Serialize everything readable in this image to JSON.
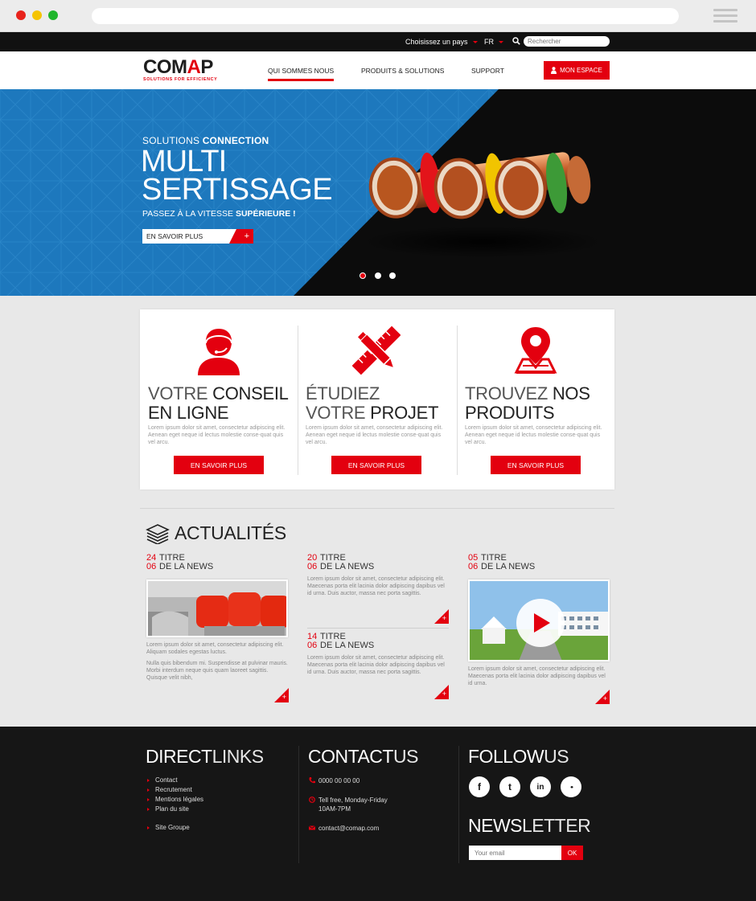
{
  "topbar": {
    "country_label": "Choisissez un pays",
    "lang_label": "FR",
    "search_placeholder": "Rechercher"
  },
  "nav": {
    "logo_text_1": "COM",
    "logo_text_a": "A",
    "logo_text_2": "P",
    "logo_tagline": "SOLUTIONS FOR EFFICIENCY",
    "items": [
      {
        "label": "QUI SOMMES NOUS",
        "active": true
      },
      {
        "label": "PRODUITS & SOLUTIONS",
        "active": false
      },
      {
        "label": "SUPPORT",
        "active": false
      }
    ],
    "espace_label": "MON ESPACE"
  },
  "hero": {
    "subtitle_light": "SOLUTIONS ",
    "subtitle_bold": "CONNECTION",
    "title_line1": "MULTI",
    "title_line2": "SERTISSAGE",
    "tagline_light": "PASSEZ À LA VITESSE ",
    "tagline_bold": "SUPÉRIEURE !",
    "cta_label": "EN SAVOIR PLUS",
    "cta_plus": "+",
    "slides_total": 3,
    "slide_active": 1
  },
  "features": [
    {
      "title_light_1": "VOTRE ",
      "title_bold_1": "CONSEIL",
      "title_light_2": "",
      "title_bold_2": "EN LIGNE",
      "text": "Lorem ipsum dolor sit amet, consectetur adipiscing elit. Aenean eget neque id lectus molestie conse-quat quis vel arcu.",
      "button": "EN SAVOIR PLUS",
      "icon": "headset-person-icon"
    },
    {
      "title_light_1": "ÉTUDIEZ",
      "title_bold_1": "",
      "title_light_2": "VOTRE ",
      "title_bold_2": "PROJET",
      "text": "Lorem ipsum dolor sit amet, consectetur adipiscing elit. Aenean eget neque id lectus molestie conse-quat quis vel arcu.",
      "button": "EN SAVOIR PLUS",
      "icon": "pencil-ruler-icon"
    },
    {
      "title_light_1": "TROUVEZ ",
      "title_bold_1": "NOS",
      "title_light_2": "",
      "title_bold_2": "PRODUITS",
      "text": "Lorem ipsum dolor sit amet, consectetur adipiscing elit. Aenean eget neque id lectus molestie conse-quat quis vel arcu.",
      "button": "EN SAVOIR PLUS",
      "icon": "map-pin-icon"
    }
  ],
  "news": {
    "heading": "ACTUALITÉS",
    "items": [
      {
        "day": "24",
        "month": "06",
        "title_1": "TITRE",
        "title_2": "DE LA NEWS",
        "text_1": "Lorem ipsum dolor sit amet, consectetur adipiscing elit. Aliquam sodales egestas luctus.",
        "text_2": "Nulla quis bibendum mi. Suspendisse at pulvinar mauris. Morbi interdum neque quis quam laoreet sagittis. Quisque velit nibh,"
      },
      {
        "day": "20",
        "month": "06",
        "title_1": "TITRE",
        "title_2": "DE LA NEWS",
        "text_1": "Lorem ipsum dolor sit amet, consectetur adipiscing elit. Maecenas porta elit lacinia dolor adipiscing dapibus vel id urna. Duis auctor, massa nec porta sagittis."
      },
      {
        "day": "14",
        "month": "06",
        "title_1": "TITRE",
        "title_2": "DE LA NEWS",
        "text_1": "Lorem ipsum dolor sit amet, consectetur adipiscing elit. Maecenas porta elit lacinia dolor adipiscing dapibus vel id urna. Duis auctor, massa nec porta sagittis."
      },
      {
        "day": "05",
        "month": "06",
        "title_1": "TITRE",
        "title_2": "DE LA NEWS",
        "text_1": "Lorem ipsum dolor sit amet, consectetur adipiscing elit. Maecenas porta elit lacinia dolor adipiscing dapibus vel id urna."
      }
    ],
    "plus": "+"
  },
  "footer": {
    "links_bold": "DIRECT",
    "links_light": "LINKS",
    "links": [
      "Contact",
      "Recrutement",
      "Mentions légales",
      "Plan du site"
    ],
    "links_group": "Site Groupe",
    "contact_bold": "CONTACT",
    "contact_light": "US",
    "phone": "0000 00 00 00",
    "hours_1": "Tell free, Monday-Friday",
    "hours_2": "10AM-7PM",
    "email": "contact@comap.com",
    "follow_bold": "FOLLOW",
    "follow_light": "US",
    "social": [
      {
        "icon": "facebook-icon",
        "glyph": "f"
      },
      {
        "icon": "twitter-icon",
        "glyph": "t"
      },
      {
        "icon": "linkedin-icon",
        "glyph": "in"
      },
      {
        "icon": "flickr-icon",
        "glyph": "••"
      }
    ],
    "news_bold": "NEWS",
    "news_light": "LETTER",
    "email_placeholder": "Your email",
    "ok_label": "OK"
  },
  "colors": {
    "brand_red": "#e3000f",
    "hero_blue": "#1f7bc1",
    "footer_bg": "#161616"
  }
}
